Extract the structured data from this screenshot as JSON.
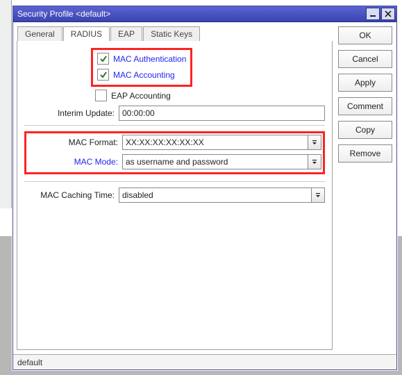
{
  "titlebar": {
    "text": "Security Profile <default>"
  },
  "tabs": [
    {
      "label": "General"
    },
    {
      "label": "RADIUS"
    },
    {
      "label": "EAP"
    },
    {
      "label": "Static Keys"
    }
  ],
  "checks": {
    "mac_auth": "MAC Authentication",
    "mac_acct": "MAC Accounting",
    "eap_acct": "EAP Accounting"
  },
  "labels": {
    "interim_update": "Interim Update:",
    "mac_format": "MAC Format:",
    "mac_mode": "MAC Mode:",
    "mac_caching": "MAC Caching Time:"
  },
  "values": {
    "interim_update": "00:00:00",
    "mac_format": "XX:XX:XX:XX:XX:XX",
    "mac_mode": "as username and password",
    "mac_caching": "disabled"
  },
  "buttons": {
    "ok": "OK",
    "cancel": "Cancel",
    "apply": "Apply",
    "comment": "Comment",
    "copy": "Copy",
    "remove": "Remove"
  },
  "status": "default"
}
